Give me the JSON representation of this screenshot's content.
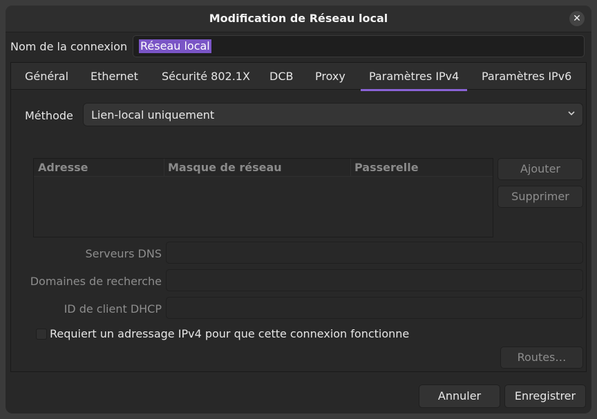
{
  "window": {
    "title": "Modification de Réseau local",
    "close_glyph": "✕"
  },
  "connection": {
    "label": "Nom de la connexion",
    "value": "Réseau local"
  },
  "tabs": [
    {
      "label": "Général",
      "active": false
    },
    {
      "label": "Ethernet",
      "active": false
    },
    {
      "label": "Sécurité 802.1X",
      "active": false
    },
    {
      "label": "DCB",
      "active": false
    },
    {
      "label": "Proxy",
      "active": false
    },
    {
      "label": "Paramètres IPv4",
      "active": true
    },
    {
      "label": "Paramètres IPv6",
      "active": false
    }
  ],
  "ipv4": {
    "method_label": "Méthode",
    "method_value": "Lien-local uniquement",
    "table": {
      "columns": [
        "Adresse",
        "Masque de réseau",
        "Passerelle"
      ],
      "rows": []
    },
    "add_label": "Ajouter",
    "delete_label": "Supprimer",
    "dns_label": "Serveurs DNS",
    "search_label": "Domaines de recherche",
    "dhcp_label": "ID de client DHCP",
    "require_label": "Requiert un adressage IPv4 pour que cette connexion fonctionne",
    "routes_label": "Routes…"
  },
  "footer": {
    "cancel_label": "Annuler",
    "save_label": "Enregistrer"
  },
  "colors": {
    "accent": "#8a63d6",
    "selection": "#7a55c6",
    "window_bg": "#282828"
  },
  "icons": {
    "close": "close-icon",
    "combo": "chevron-down-icon"
  }
}
